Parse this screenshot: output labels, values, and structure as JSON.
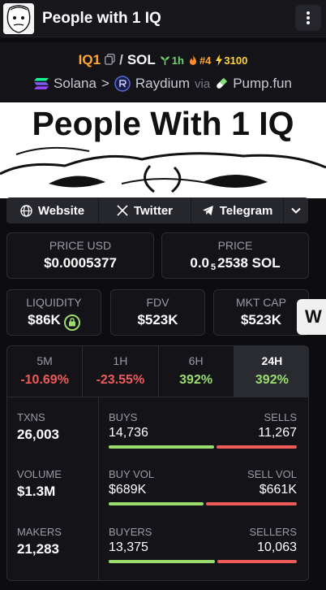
{
  "header": {
    "title": "People with 1 IQ",
    "menu_icon": "more-vertical-icon"
  },
  "pair": {
    "base": "IQ1",
    "separator": "/",
    "quote": "SOL",
    "age": "1h",
    "rank": "#4",
    "boosts": "3100"
  },
  "chain": {
    "network": "Solana",
    "separator": ">",
    "dex": "Raydium",
    "via": "via",
    "launchpad": "Pump.fun"
  },
  "banner": {
    "text": "People With 1 IQ"
  },
  "links": {
    "website": "Website",
    "twitter": "Twitter",
    "telegram": "Telegram"
  },
  "price": {
    "usd_label": "PRICE USD",
    "usd_value": "$0.0005377",
    "native_label": "PRICE",
    "native_prefix": "0.0",
    "native_sub": "5",
    "native_rest": "2538 SOL"
  },
  "metrics": {
    "liquidity_label": "LIQUIDITY",
    "liquidity_value": "$86K",
    "fdv_label": "FDV",
    "fdv_value": "$523K",
    "mcap_label": "MKT CAP",
    "mcap_value": "$523K"
  },
  "side_badge": "W",
  "timeframes": [
    {
      "label": "5M",
      "value": "-10.69%"
    },
    {
      "label": "1H",
      "value": "-23.55%"
    },
    {
      "label": "6H",
      "value": "392%"
    },
    {
      "label": "24H",
      "value": "392%"
    }
  ],
  "stats": {
    "txns_label": "TXNS",
    "txns_value": "26,003",
    "volume_label": "VOLUME",
    "volume_value": "$1.3M",
    "makers_label": "MAKERS",
    "makers_value": "21,283",
    "buys_label": "BUYS",
    "buys_value": "14,736",
    "sells_label": "SELLS",
    "sells_value": "11,267",
    "buyvol_label": "BUY VOL",
    "buyvol_value": "$689K",
    "sellvol_label": "SELL VOL",
    "sellvol_value": "$661K",
    "buyers_label": "BUYERS",
    "buyers_value": "13,375",
    "sellers_label": "SELLERS",
    "sellers_value": "10,063"
  },
  "colors": {
    "positive": "#9bdc6f",
    "negative": "#ef5a5a",
    "accent": "#ffa733"
  }
}
